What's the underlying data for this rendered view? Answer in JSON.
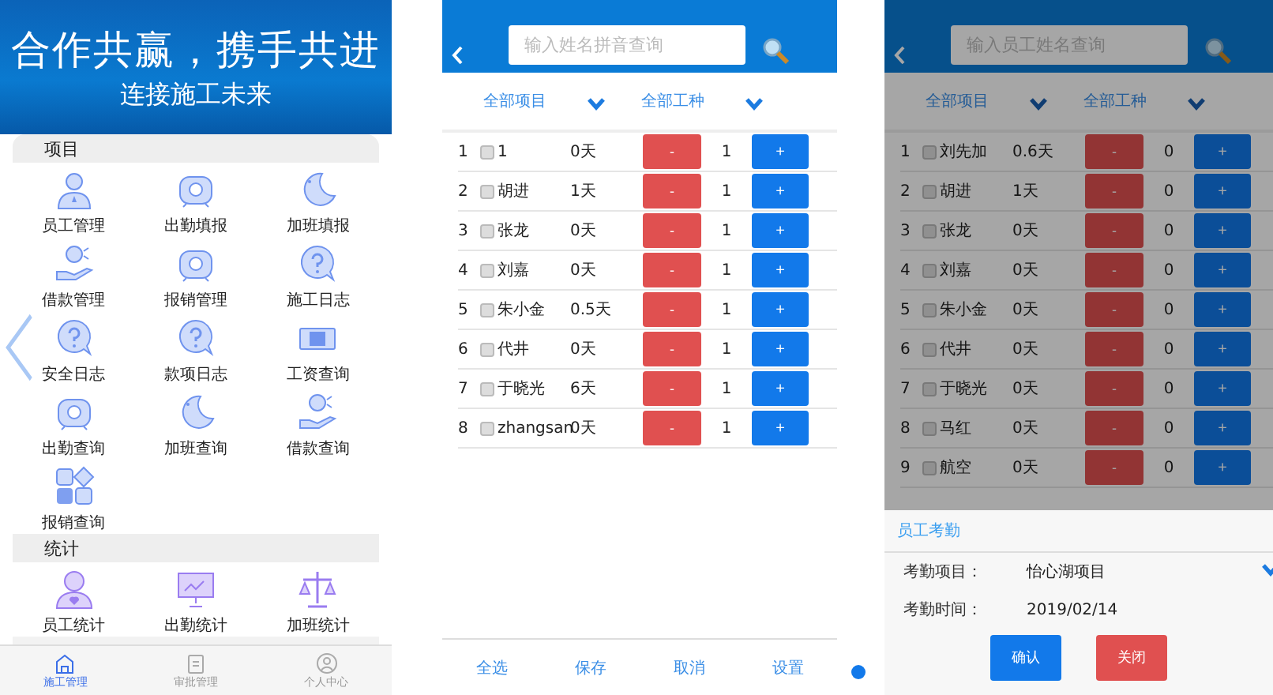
{
  "home": {
    "banner": {
      "headline": "合作共赢，携手共进",
      "subline": "连接施工未来"
    },
    "sections": [
      {
        "title": "项目",
        "items": [
          {
            "label": "员工管理",
            "kind": "person"
          },
          {
            "label": "出勤填报",
            "kind": "clock"
          },
          {
            "label": "加班填报",
            "kind": "moon"
          },
          {
            "label": "借款管理",
            "kind": "hand"
          },
          {
            "label": "报销管理",
            "kind": "clock"
          },
          {
            "label": "施工日志",
            "kind": "question"
          },
          {
            "label": "安全日志",
            "kind": "question"
          },
          {
            "label": "款项日志",
            "kind": "question"
          },
          {
            "label": "工资查询",
            "kind": "banknote"
          },
          {
            "label": "出勤查询",
            "kind": "clock"
          },
          {
            "label": "加班查询",
            "kind": "moon"
          },
          {
            "label": "借款查询",
            "kind": "hand"
          },
          {
            "label": "报销查询",
            "kind": "grid"
          }
        ]
      },
      {
        "title": "统计",
        "items": [
          {
            "label": "员工统计",
            "kind": "person-heart"
          },
          {
            "label": "出勤统计",
            "kind": "board"
          },
          {
            "label": "加班统计",
            "kind": "scale"
          }
        ]
      }
    ],
    "tabs": [
      {
        "label": "施工管理",
        "kind": "home",
        "selected": true
      },
      {
        "label": "审批管理",
        "kind": "clipboard",
        "selected": false
      },
      {
        "label": "个人中心",
        "kind": "user",
        "selected": false
      }
    ]
  },
  "attendance": {
    "search": {
      "placeholder": "输入姓名拼音查询"
    },
    "filters": [
      "全部项目",
      "全部工种"
    ],
    "rows": [
      {
        "no": "1",
        "name": "1",
        "days": "0天",
        "minus": "-",
        "count": "1",
        "plus": "+",
        "checked": false
      },
      {
        "no": "2",
        "name": "胡进",
        "days": "1天",
        "minus": "-",
        "count": "1",
        "plus": "+",
        "checked": false
      },
      {
        "no": "3",
        "name": "张龙",
        "days": "0天",
        "minus": "-",
        "count": "1",
        "plus": "+",
        "checked": false
      },
      {
        "no": "4",
        "name": "刘嘉",
        "days": "0天",
        "minus": "-",
        "count": "1",
        "plus": "+",
        "checked": false
      },
      {
        "no": "5",
        "name": "朱小金",
        "days": "0.5天",
        "minus": "-",
        "count": "1",
        "plus": "+",
        "checked": false
      },
      {
        "no": "6",
        "name": "代井",
        "days": "0天",
        "minus": "-",
        "count": "1",
        "plus": "+",
        "checked": false
      },
      {
        "no": "7",
        "name": "于晓光",
        "days": "6天",
        "minus": "-",
        "count": "1",
        "plus": "+",
        "checked": false
      },
      {
        "no": "8",
        "name": "zhangsan",
        "days": "0天",
        "minus": "-",
        "count": "1",
        "plus": "+",
        "checked": false
      }
    ],
    "actions": [
      "全选",
      "保存",
      "取消",
      "设置"
    ]
  },
  "attendance_dialog": {
    "search": {
      "placeholder": "输入员工姓名查询"
    },
    "filters": [
      "全部项目",
      "全部工种"
    ],
    "rows": [
      {
        "no": "1",
        "name": "刘先加",
        "days": "0.6天",
        "minus": "-",
        "count": "0",
        "plus": "+",
        "checked": false
      },
      {
        "no": "2",
        "name": "胡进",
        "days": "1天",
        "minus": "-",
        "count": "0",
        "plus": "+",
        "checked": false
      },
      {
        "no": "3",
        "name": "张龙",
        "days": "0天",
        "minus": "-",
        "count": "0",
        "plus": "+",
        "checked": false
      },
      {
        "no": "4",
        "name": "刘嘉",
        "days": "0天",
        "minus": "-",
        "count": "0",
        "plus": "+",
        "checked": false
      },
      {
        "no": "5",
        "name": "朱小金",
        "days": "0天",
        "minus": "-",
        "count": "0",
        "plus": "+",
        "checked": false
      },
      {
        "no": "6",
        "name": "代井",
        "days": "0天",
        "minus": "-",
        "count": "0",
        "plus": "+",
        "checked": false
      },
      {
        "no": "7",
        "name": "于晓光",
        "days": "0天",
        "minus": "-",
        "count": "0",
        "plus": "+",
        "checked": false
      },
      {
        "no": "8",
        "name": "马红",
        "days": "0天",
        "minus": "-",
        "count": "0",
        "plus": "+",
        "checked": false
      },
      {
        "no": "9",
        "name": "航空",
        "days": "0天",
        "minus": "-",
        "count": "0",
        "plus": "+",
        "checked": false
      }
    ],
    "dialog": {
      "title": "员工考勤",
      "fields": [
        {
          "label": "考勤项目：",
          "value": "怡心湖项目",
          "dropdown": true
        },
        {
          "label": "考勤时间：",
          "value": "2019/02/14",
          "dropdown": false
        }
      ],
      "buttons": [
        {
          "label": "确认",
          "kind": "confirm"
        },
        {
          "label": "关闭",
          "kind": "close"
        }
      ]
    }
  }
}
